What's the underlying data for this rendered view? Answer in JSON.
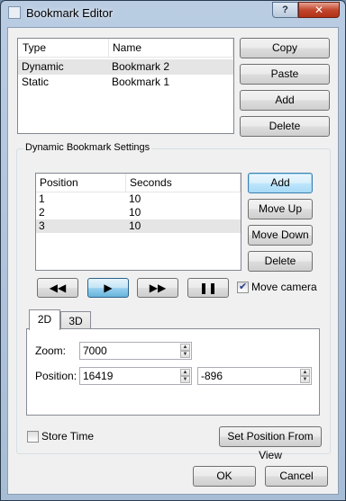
{
  "window": {
    "title": "Bookmark Editor",
    "help_label": "?",
    "close_label": "✕",
    "icon": "app-icon"
  },
  "bookmarks": {
    "columns": [
      "Type",
      "Name"
    ],
    "rows": [
      {
        "type": "Dynamic",
        "name": "Bookmark 2",
        "selected": true
      },
      {
        "type": "Static",
        "name": "Bookmark 1",
        "selected": false
      }
    ],
    "buttons": {
      "copy": "Copy",
      "paste": "Paste",
      "add": "Add",
      "delete": "Delete"
    }
  },
  "dynamic": {
    "group_title": "Dynamic Bookmark Settings",
    "columns": [
      "Position",
      "Seconds"
    ],
    "rows": [
      {
        "position": "1",
        "seconds": "10",
        "selected": false
      },
      {
        "position": "2",
        "seconds": "10",
        "selected": false
      },
      {
        "position": "3",
        "seconds": "10",
        "selected": true
      }
    ],
    "buttons": {
      "add": "Add",
      "move_up": "Move Up",
      "move_down": "Move Down",
      "delete": "Delete"
    },
    "playback": {
      "rewind": "skip-back-icon",
      "play": "play-icon",
      "forward": "fast-forward-icon",
      "pause": "pause-icon",
      "active": "play"
    },
    "move_camera": {
      "label": "Move camera",
      "checked": true
    }
  },
  "view": {
    "tabs": [
      "2D",
      "3D"
    ],
    "active_tab": "2D",
    "zoom_label": "Zoom:",
    "zoom_value": "7000",
    "position_label": "Position:",
    "position_x": "16419",
    "position_y": "-896"
  },
  "store_time": {
    "label": "Store Time",
    "checked": false
  },
  "set_position_button": "Set Position From View",
  "ok_button": "OK",
  "cancel_button": "Cancel"
}
